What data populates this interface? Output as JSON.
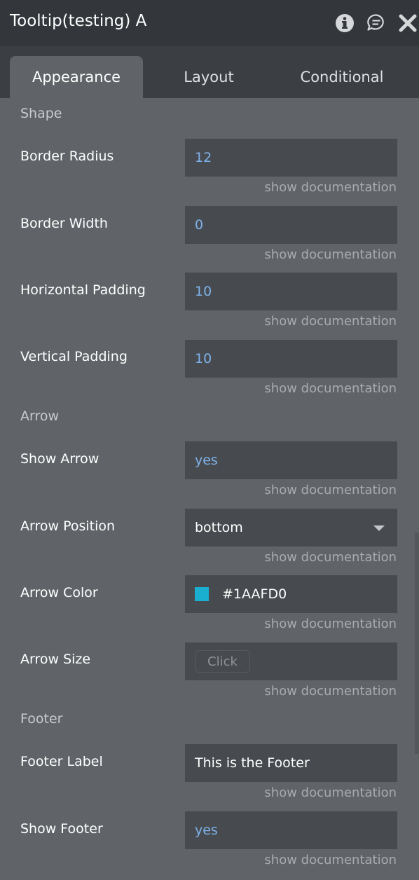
{
  "header": {
    "title": "Tooltip(testing) A"
  },
  "tabs": {
    "appearance": "Appearance",
    "layout": "Layout",
    "conditional": "Conditional"
  },
  "sections": {
    "shape": "Shape",
    "arrow": "Arrow",
    "footer": "Footer"
  },
  "doc_link": "show documentation",
  "fields": {
    "border_radius": {
      "label": "Border Radius",
      "value": "12"
    },
    "border_width": {
      "label": "Border Width",
      "value": "0"
    },
    "horizontal_padding": {
      "label": "Horizontal Padding",
      "value": "10"
    },
    "vertical_padding": {
      "label": "Vertical Padding",
      "value": "10"
    },
    "show_arrow": {
      "label": "Show Arrow",
      "value": "yes"
    },
    "arrow_position": {
      "label": "Arrow Position",
      "value": "bottom"
    },
    "arrow_color": {
      "label": "Arrow Color",
      "value": "#1AAFD0",
      "swatch": "#1aafd0"
    },
    "arrow_size": {
      "label": "Arrow Size",
      "button": "Click"
    },
    "footer_label": {
      "label": "Footer Label",
      "value": "This is the Footer"
    },
    "show_footer": {
      "label": "Show Footer",
      "value": "yes"
    }
  },
  "icons": {
    "info": "info-icon",
    "comment": "comment-icon",
    "close": "close-icon",
    "dropdown": "chevron-down-icon"
  },
  "colors": {
    "header_bg": "#33373b",
    "panel_bg": "#606468",
    "field_bg": "#474b4f",
    "value_blue": "#7fb2ea"
  }
}
